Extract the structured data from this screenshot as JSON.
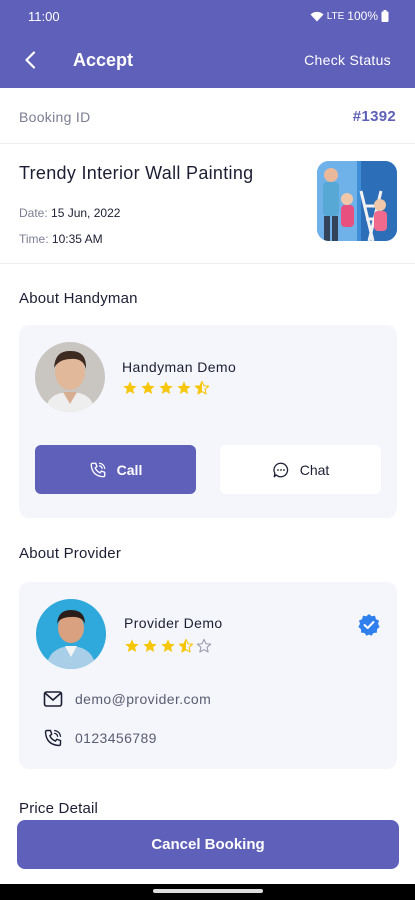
{
  "status_bar": {
    "time": "11:00",
    "network": "LTE",
    "battery": "100%"
  },
  "app_bar": {
    "title": "Accept",
    "check_status": "Check Status"
  },
  "booking": {
    "id_label": "Booking ID",
    "id_value": "#1392",
    "service_title": "Trendy Interior Wall  Painting",
    "date_label": "Date:",
    "date_value": "15 Jun, 2022",
    "time_label": "Time:",
    "time_value": "10:35 AM"
  },
  "handyman": {
    "section_title": "About Handyman",
    "name": "Handyman Demo",
    "rating": 4.5,
    "call_label": "Call",
    "chat_label": "Chat"
  },
  "provider": {
    "section_title": "About Provider",
    "name": "Provider Demo",
    "rating": 3.5,
    "email": "demo@provider.com",
    "phone": "0123456789"
  },
  "price": {
    "section_title": "Price Detail"
  },
  "cancel_label": "Cancel Booking",
  "colors": {
    "primary": "#5f60b9",
    "star": "#f5c609",
    "verified": "#2f80ed",
    "card_bg": "#f5f6fb"
  }
}
